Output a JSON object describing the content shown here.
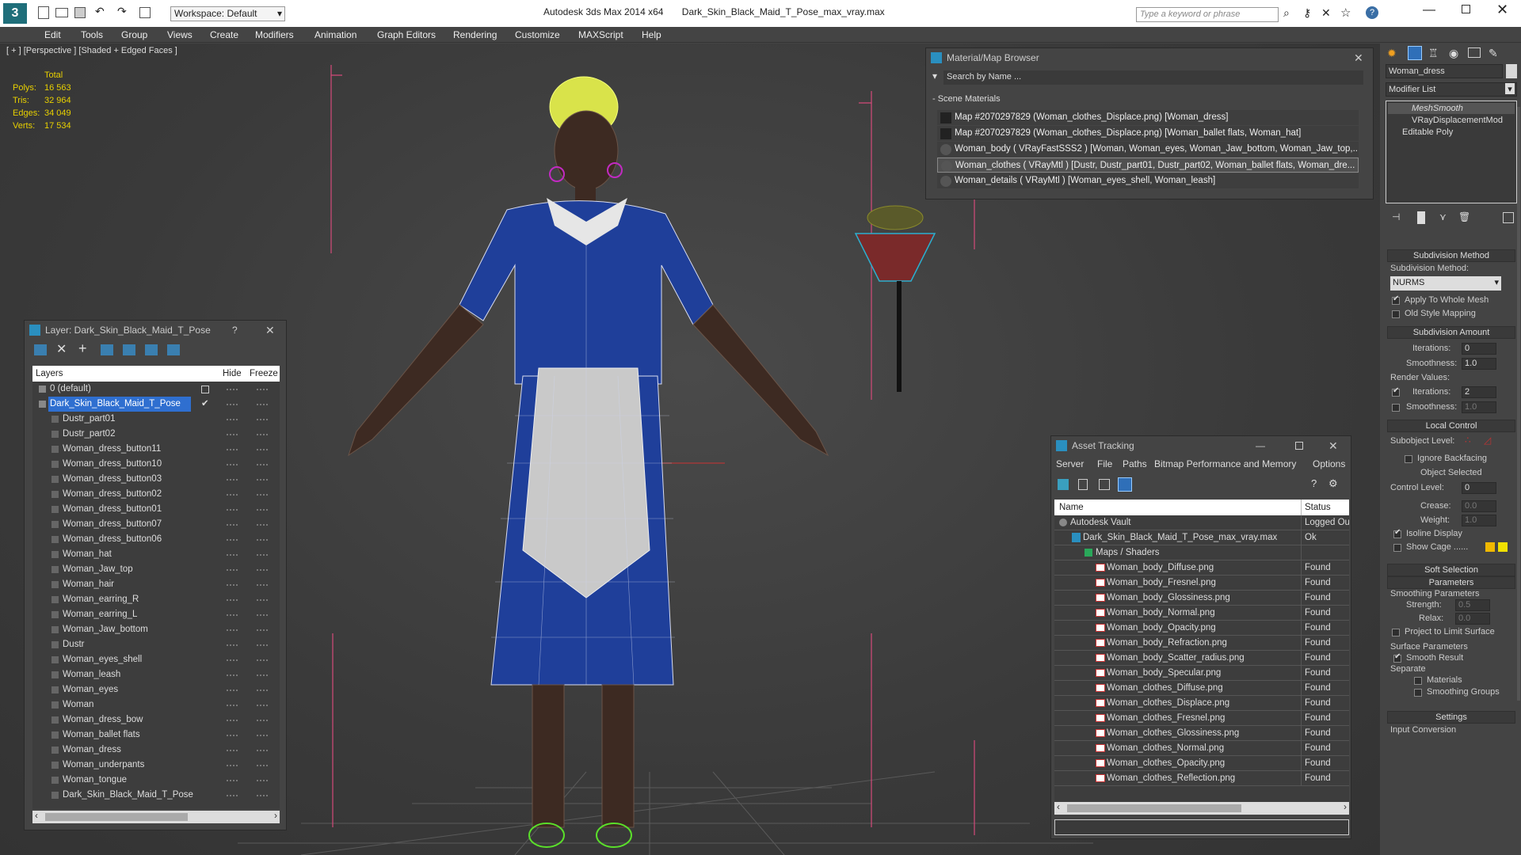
{
  "app": {
    "title": "Autodesk 3ds Max  2014 x64",
    "file": "Dark_Skin_Black_Maid_T_Pose_max_vray.max",
    "workspace": "Workspace: Default",
    "search_placeholder": "Type a keyword or phrase"
  },
  "menu": [
    "Edit",
    "Tools",
    "Group",
    "Views",
    "Create",
    "Modifiers",
    "Animation",
    "Graph Editors",
    "Rendering",
    "Customize",
    "MAXScript",
    "Help"
  ],
  "viewport": {
    "label": "[ + ] [Perspective ] [Shaded + Edged Faces ]",
    "stats_header": "Total",
    "stats": [
      {
        "label": "Polys:",
        "value": "16 563"
      },
      {
        "label": "Tris:",
        "value": "32 964"
      },
      {
        "label": "Edges:",
        "value": "34 049"
      },
      {
        "label": "Verts:",
        "value": "17 534"
      }
    ]
  },
  "layer_panel": {
    "title": "Layer: Dark_Skin_Black_Maid_T_Pose",
    "help": "?",
    "col_layers": "Layers",
    "col_hide": "Hide",
    "col_freeze": "Freeze",
    "items": [
      "0 (default)",
      "Dark_Skin_Black_Maid_T_Pose",
      "Dustr_part01",
      "Dustr_part02",
      "Woman_dress_button11",
      "Woman_dress_button10",
      "Woman_dress_button03",
      "Woman_dress_button02",
      "Woman_dress_button01",
      "Woman_dress_button07",
      "Woman_dress_button06",
      "Woman_hat",
      "Woman_Jaw_top",
      "Woman_hair",
      "Woman_earring_R",
      "Woman_earring_L",
      "Woman_Jaw_bottom",
      "Dustr",
      "Woman_eyes_shell",
      "Woman_leash",
      "Woman_eyes",
      "Woman",
      "Woman_dress_bow",
      "Woman_ballet flats",
      "Woman_dress",
      "Woman_underpants",
      "Woman_tongue",
      "Dark_Skin_Black_Maid_T_Pose"
    ]
  },
  "material_browser": {
    "title": "Material/Map Browser",
    "search": "Search by Name ...",
    "group": "- Scene Materials",
    "items": [
      "Map #2070297829 (Woman_clothes_Displace.png) [Woman_dress]",
      "Map #2070297829 (Woman_clothes_Displace.png) [Woman_ballet flats, Woman_hat]",
      "Woman_body  ( VRayFastSSS2 )  [Woman, Woman_eyes, Woman_Jaw_bottom, Woman_Jaw_top,...",
      "Woman_clothes  ( VRayMtl )  [Dustr, Dustr_part01, Dustr_part02, Woman_ballet flats, Woman_dre...",
      "Woman_details  ( VRayMtl )  [Woman_eyes_shell, Woman_leash]"
    ]
  },
  "asset_tracking": {
    "title": "Asset Tracking",
    "menu": [
      "Server",
      "File",
      "Paths",
      "Bitmap Performance and Memory",
      "Options"
    ],
    "col_name": "Name",
    "col_status": "Status",
    "rows": [
      {
        "name": "Autodesk Vault",
        "status": "Logged Ou",
        "level": 1,
        "kind": "vault"
      },
      {
        "name": "Dark_Skin_Black_Maid_T_Pose_max_vray.max",
        "status": "Ok",
        "level": 2,
        "kind": "max"
      },
      {
        "name": "Maps / Shaders",
        "status": "",
        "level": 3,
        "kind": "folder"
      },
      {
        "name": "Woman_body_Diffuse.png",
        "status": "Found",
        "level": 4,
        "kind": "png"
      },
      {
        "name": "Woman_body_Fresnel.png",
        "status": "Found",
        "level": 4,
        "kind": "png"
      },
      {
        "name": "Woman_body_Glossiness.png",
        "status": "Found",
        "level": 4,
        "kind": "png"
      },
      {
        "name": "Woman_body_Normal.png",
        "status": "Found",
        "level": 4,
        "kind": "png"
      },
      {
        "name": "Woman_body_Opacity.png",
        "status": "Found",
        "level": 4,
        "kind": "png"
      },
      {
        "name": "Woman_body_Refraction.png",
        "status": "Found",
        "level": 4,
        "kind": "png"
      },
      {
        "name": "Woman_body_Scatter_radius.png",
        "status": "Found",
        "level": 4,
        "kind": "png"
      },
      {
        "name": "Woman_body_Specular.png",
        "status": "Found",
        "level": 4,
        "kind": "png"
      },
      {
        "name": "Woman_clothes_Diffuse.png",
        "status": "Found",
        "level": 4,
        "kind": "png"
      },
      {
        "name": "Woman_clothes_Displace.png",
        "status": "Found",
        "level": 4,
        "kind": "png"
      },
      {
        "name": "Woman_clothes_Fresnel.png",
        "status": "Found",
        "level": 4,
        "kind": "png"
      },
      {
        "name": "Woman_clothes_Glossiness.png",
        "status": "Found",
        "level": 4,
        "kind": "png"
      },
      {
        "name": "Woman_clothes_Normal.png",
        "status": "Found",
        "level": 4,
        "kind": "png"
      },
      {
        "name": "Woman_clothes_Opacity.png",
        "status": "Found",
        "level": 4,
        "kind": "png"
      },
      {
        "name": "Woman_clothes_Reflection.png",
        "status": "Found",
        "level": 4,
        "kind": "png"
      }
    ]
  },
  "command_panel": {
    "object_name": "Woman_dress",
    "modifier_list": "Modifier List",
    "stack": [
      "MeshSmooth",
      "VRayDisplacementMod",
      "Editable Poly"
    ],
    "subdivision_method": "Subdivision Method",
    "subdivision_method_label": "Subdivision Method:",
    "method_value": "NURMS",
    "apply_whole_mesh": "Apply To Whole Mesh",
    "old_style_mapping": "Old Style Mapping",
    "subdivision_amount": "Subdivision Amount",
    "iterations_label": "Iterations:",
    "iterations": "0",
    "smoothness_label": "Smoothness:",
    "smoothness": "1.0",
    "render_values": "Render Values:",
    "render_iterations": "2",
    "render_smoothness": "1.0",
    "local_control": "Local Control",
    "subobject_level": "Subobject Level:",
    "ignore_backfacing": "Ignore Backfacing",
    "object_selected": "Object Selected",
    "control_level": "Control Level:",
    "control_level_value": "0",
    "crease": "Crease:",
    "crease_value": "0.0",
    "weight": "Weight:",
    "weight_value": "1.0",
    "isoline_display": "Isoline Display",
    "show_cage": "Show Cage ......",
    "soft_selection": "Soft Selection",
    "parameters": "Parameters",
    "smoothing_parameters": "Smoothing Parameters",
    "strength": "Strength:",
    "strength_value": "0.5",
    "relax": "Relax:",
    "relax_value": "0.0",
    "project_limit": "Project to Limit Surface",
    "surface_parameters": "Surface Parameters",
    "smooth_result": "Smooth Result",
    "separate": "Separate",
    "materials": "Materials",
    "smoothing_groups": "Smoothing Groups",
    "settings": "Settings",
    "input_conversion": "Input Conversion"
  }
}
